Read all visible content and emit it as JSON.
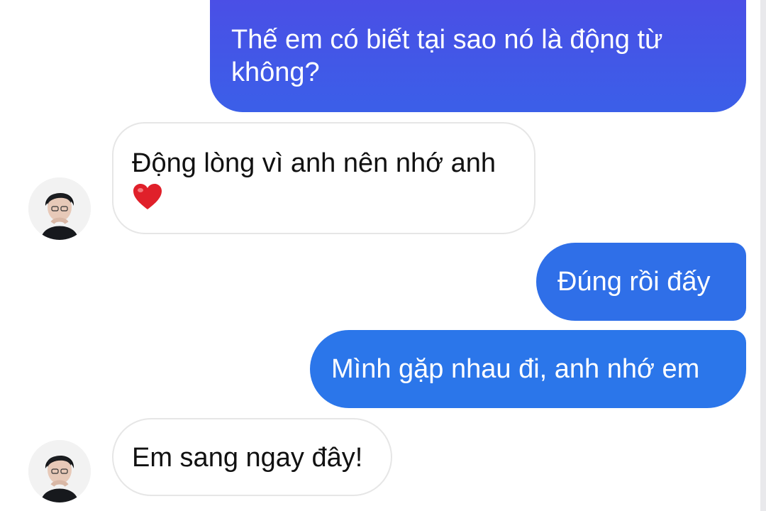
{
  "messages": [
    {
      "id": "m1",
      "direction": "outgoing",
      "text": "Thế em có biết tại sao nó là động từ không?"
    },
    {
      "id": "m2",
      "direction": "incoming",
      "text": "Động lòng vì anh nên nhớ anh",
      "emoji": "heart"
    },
    {
      "id": "m3",
      "direction": "outgoing",
      "text": "Đúng rồi đấy"
    },
    {
      "id": "m4",
      "direction": "outgoing",
      "text": "Mình gặp nhau đi, anh nhớ em"
    },
    {
      "id": "m5",
      "direction": "incoming",
      "text": "Em sang ngay đây!"
    }
  ],
  "colors": {
    "outgoing_gradient_top": "#4a4fe6",
    "outgoing_gradient_bottom": "#3b5fe8",
    "outgoing_mid": "#2f6fe8",
    "outgoing_last": "#2b76ea",
    "incoming_border": "#e6e6e6",
    "heart": "#e0202a"
  }
}
